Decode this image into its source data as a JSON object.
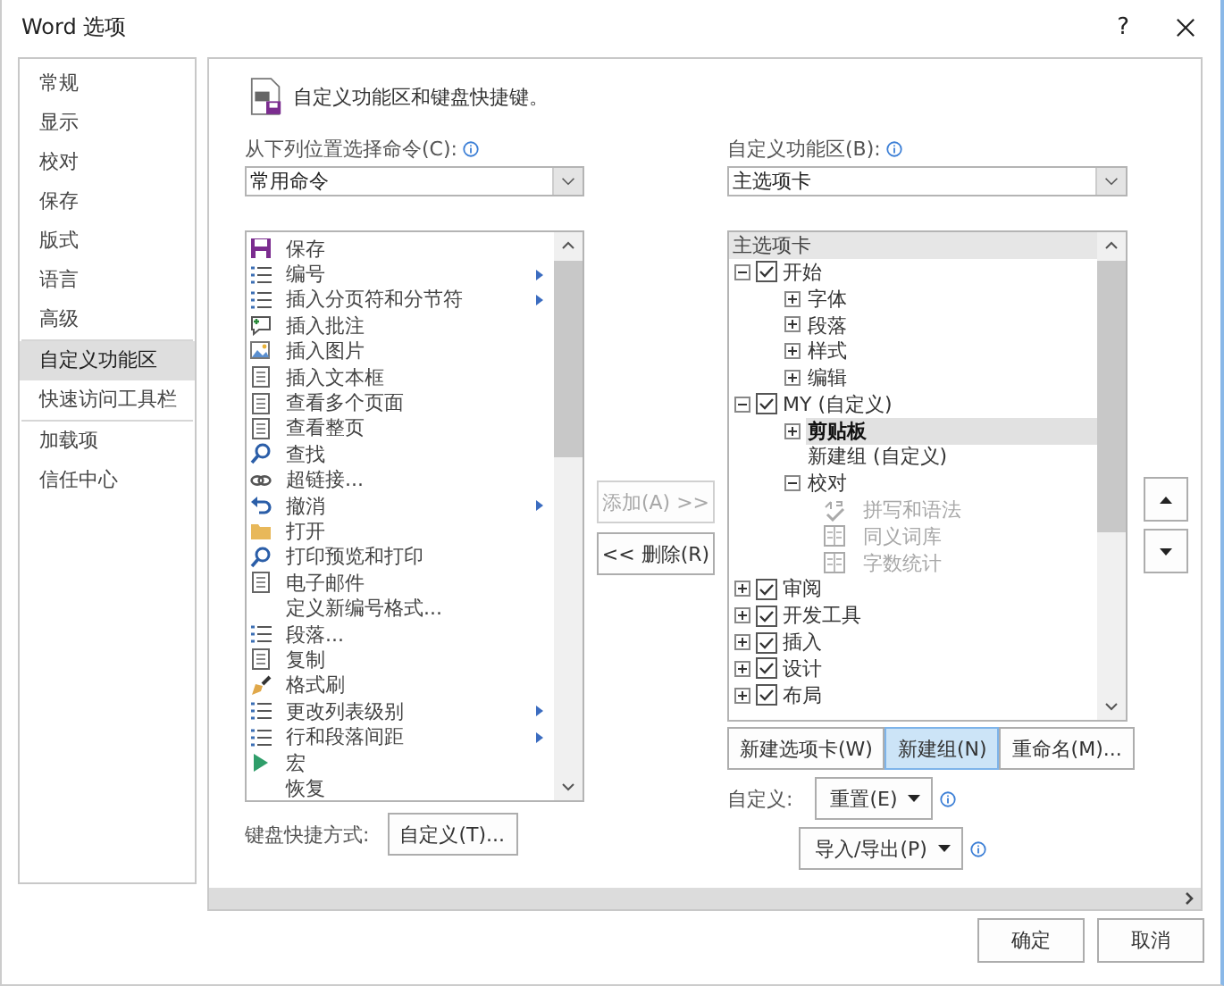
{
  "window": {
    "title": "Word 选项",
    "help": "?"
  },
  "sidebar": {
    "sections": [
      [
        {
          "label": "常规",
          "selected": false
        },
        {
          "label": "显示",
          "selected": false
        },
        {
          "label": "校对",
          "selected": false
        },
        {
          "label": "保存",
          "selected": false
        },
        {
          "label": "版式",
          "selected": false
        },
        {
          "label": "语言",
          "selected": false
        },
        {
          "label": "高级",
          "selected": false
        }
      ],
      [
        {
          "label": "自定义功能区",
          "selected": true
        },
        {
          "label": "快速访问工具栏",
          "selected": false
        }
      ],
      [
        {
          "label": "加载项",
          "selected": false
        },
        {
          "label": "信任中心",
          "selected": false
        }
      ]
    ]
  },
  "header": "自定义功能区和键盘快捷键。",
  "commands_source": {
    "label": "从下列位置选择命令(C):",
    "value": "常用命令"
  },
  "commands": [
    {
      "label": "保存",
      "icon": true,
      "submenu": false
    },
    {
      "label": "编号",
      "icon": true,
      "submenu": true
    },
    {
      "label": "插入分页符和分节符",
      "icon": true,
      "submenu": true
    },
    {
      "label": "插入批注",
      "icon": true,
      "submenu": false
    },
    {
      "label": "插入图片",
      "icon": true,
      "submenu": false
    },
    {
      "label": "插入文本框",
      "icon": true,
      "submenu": false
    },
    {
      "label": "查看多个页面",
      "icon": true,
      "submenu": false
    },
    {
      "label": "查看整页",
      "icon": true,
      "submenu": false
    },
    {
      "label": "查找",
      "icon": true,
      "submenu": false
    },
    {
      "label": "超链接...",
      "icon": true,
      "submenu": false
    },
    {
      "label": "撤消",
      "icon": true,
      "submenu": true
    },
    {
      "label": "打开",
      "icon": true,
      "submenu": false
    },
    {
      "label": "打印预览和打印",
      "icon": true,
      "submenu": false
    },
    {
      "label": "电子邮件",
      "icon": true,
      "submenu": false
    },
    {
      "label": "定义新编号格式...",
      "icon": false,
      "submenu": false
    },
    {
      "label": "段落...",
      "icon": true,
      "submenu": false
    },
    {
      "label": "复制",
      "icon": true,
      "submenu": false
    },
    {
      "label": "格式刷",
      "icon": true,
      "submenu": false
    },
    {
      "label": "更改列表级别",
      "icon": true,
      "submenu": true
    },
    {
      "label": "行和段落间距",
      "icon": true,
      "submenu": true
    },
    {
      "label": "宏",
      "icon": true,
      "submenu": false
    },
    {
      "label": "恢复",
      "icon": false,
      "submenu": false
    }
  ],
  "keyboard": {
    "label": "键盘快捷方式:",
    "button": "自定义(T)..."
  },
  "transfer_buttons": [
    {
      "label": "添加(A) >>",
      "disabled": true
    },
    {
      "label": "<< 删除(R)",
      "disabled": false
    }
  ],
  "ribbon_source": {
    "label": "自定义功能区(B):",
    "value": "主选项卡"
  },
  "ribbon_tree": {
    "heading": "主选项卡",
    "items": [
      {
        "kind": "tab",
        "label": "开始",
        "checked": true,
        "expanded": true,
        "selected": false,
        "children": [
          {
            "kind": "group",
            "label": "字体",
            "expanded": false,
            "selected": false
          },
          {
            "kind": "group",
            "label": "段落",
            "expanded": false,
            "selected": false
          },
          {
            "kind": "group",
            "label": "样式",
            "expanded": false,
            "selected": false
          },
          {
            "kind": "group",
            "label": "编辑",
            "expanded": false,
            "selected": false
          }
        ]
      },
      {
        "kind": "tab",
        "label": "MY (自定义)",
        "checked": true,
        "expanded": true,
        "selected": false,
        "children": [
          {
            "kind": "group",
            "label": "剪贴板",
            "expanded": false,
            "selected": true
          },
          {
            "kind": "empty-group",
            "label": "新建组 (自定义)",
            "selected": false
          },
          {
            "kind": "group",
            "label": "校对",
            "expanded": true,
            "selected": false,
            "children": [
              {
                "kind": "command",
                "label": "拼写和语法",
                "disabled": true,
                "selected": false
              },
              {
                "kind": "command",
                "label": "同义词库",
                "disabled": true,
                "selected": false
              },
              {
                "kind": "command",
                "label": "字数统计",
                "disabled": true,
                "selected": false
              }
            ]
          }
        ]
      },
      {
        "kind": "tab",
        "label": "审阅",
        "checked": true,
        "expanded": false,
        "selected": false
      },
      {
        "kind": "tab",
        "label": "开发工具",
        "checked": true,
        "expanded": false,
        "selected": false
      },
      {
        "kind": "tab",
        "label": "插入",
        "checked": true,
        "expanded": false,
        "selected": false
      },
      {
        "kind": "tab",
        "label": "设计",
        "checked": true,
        "expanded": false,
        "selected": false
      },
      {
        "kind": "tab",
        "label": "布局",
        "checked": true,
        "expanded": false,
        "selected": false
      }
    ]
  },
  "tree_buttons": [
    {
      "label": "新建选项卡(W)",
      "highlighted": false
    },
    {
      "label": "新建组(N)",
      "highlighted": true
    },
    {
      "label": "重命名(M)...",
      "highlighted": false
    }
  ],
  "customize": {
    "label": "自定义:",
    "reset": "重置(E)",
    "import_export": "导入/导出(P)"
  },
  "footer_buttons": [
    "确定",
    "取消"
  ]
}
